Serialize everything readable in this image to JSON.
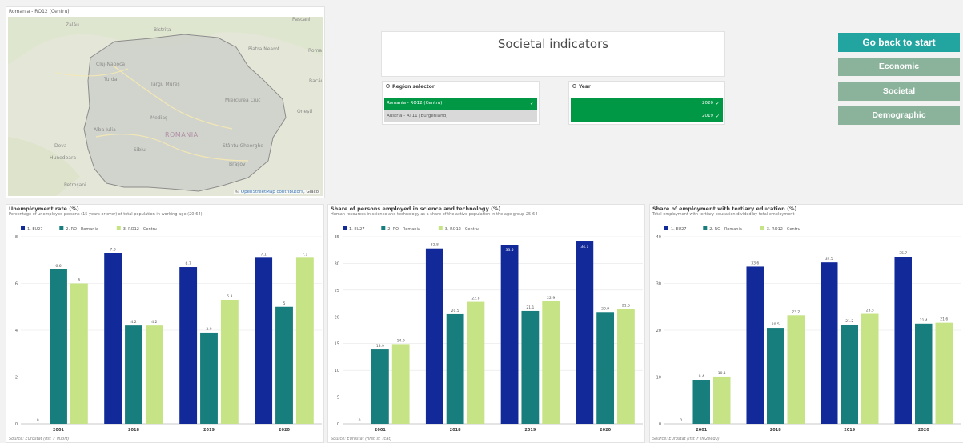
{
  "map": {
    "title": "Romania - RO12 (Centru)",
    "country_label": "ROMANIA",
    "places": [
      "Zalău",
      "Bistrița",
      "Pașcani",
      "Piatra Neamț",
      "Roma",
      "Cluj-Napoca",
      "Turda",
      "Târgu Mureș",
      "Bacău",
      "Miercurea Ciuc",
      "Onești",
      "Mediaș",
      "Alba Iulia",
      "Deva",
      "Sibiu",
      "Sfântu Gheorghe",
      "Hunedoara",
      "Brașov",
      "Petroșani"
    ],
    "attribution_prefix": "© ",
    "attribution_link": "OpenStreetMap contributors",
    "attribution_suffix": ", Glaco"
  },
  "header": {
    "title": "Societal indicators"
  },
  "region_filter": {
    "label": "Region selector",
    "items": [
      {
        "label": "Romania - RO12 (Centru)",
        "selected": true,
        "check": "✓"
      },
      {
        "label": "Austria - AT11 (Burgenland)",
        "selected": false,
        "check": ""
      }
    ]
  },
  "year_filter": {
    "label": "Year",
    "items": [
      {
        "label": "2020",
        "selected": true,
        "check": "✓"
      },
      {
        "label": "2019",
        "selected": true,
        "check": "✓"
      }
    ]
  },
  "nav": {
    "start": "Go back to start",
    "economic": "Economic",
    "societal": "Societal",
    "demographic": "Demographic"
  },
  "colors": {
    "eu27": "#12299a",
    "ro": "#177d7d",
    "region": "#c6e486",
    "select_green": "#009845",
    "start_btn": "#22a4a0",
    "nav_btn": "#8bb39b"
  },
  "chart_data": [
    {
      "type": "bar",
      "title": "Unemployment rate (%)",
      "subtitle": "Percentage of unemployed persons (15 years or over) of total population in working-age (20-64)",
      "source": "Source: Eurostat (lfst_r_lfu3rt)",
      "categories": [
        "2001",
        "2018",
        "2019",
        "2020"
      ],
      "series": [
        {
          "name": "1. EU27",
          "values": [
            0,
            7.3,
            6.7,
            7.1
          ],
          "labels": [
            "0",
            "7.3",
            "6.7",
            "7.1"
          ]
        },
        {
          "name": "2. RO - Romania",
          "values": [
            6.6,
            4.2,
            3.9,
            5
          ],
          "labels": [
            "6.6",
            "4.2",
            "3.9",
            "5"
          ]
        },
        {
          "name": "3. RO12 - Centru",
          "values": [
            6,
            4.2,
            5.3,
            7.1
          ],
          "labels": [
            "6",
            "4.2",
            "5.3",
            "7.1"
          ]
        }
      ],
      "ylim": [
        0,
        8
      ],
      "yticks": [
        0,
        2,
        4,
        6,
        8
      ],
      "legend": "top-left",
      "grid": true
    },
    {
      "type": "bar",
      "title": "Share of persons employed in science and technology (%)",
      "subtitle": "Human resources in science and technology as a share of the active population in the age group 25-64",
      "source": "Source: Eurostat (hrst_st_rcat)",
      "categories": [
        "2001",
        "2018",
        "2019",
        "2020"
      ],
      "series": [
        {
          "name": "1. EU27",
          "values": [
            0,
            32.8,
            33.5,
            34.1
          ],
          "labels": [
            "0",
            "32.8",
            "33.5",
            "34.1"
          ]
        },
        {
          "name": "2. RO - Romania",
          "values": [
            13.9,
            20.5,
            21.1,
            20.9
          ],
          "labels": [
            "13.9",
            "20.5",
            "21.1",
            "20.9"
          ]
        },
        {
          "name": "3. RO12 - Centru",
          "values": [
            14.9,
            22.8,
            22.9,
            21.5
          ],
          "labels": [
            "14.9",
            "22.8",
            "22.9",
            "21.5"
          ]
        }
      ],
      "ylim": [
        0,
        35
      ],
      "yticks": [
        0,
        5,
        10,
        15,
        20,
        25,
        30,
        35
      ],
      "legend": "top-left",
      "grid": true
    },
    {
      "type": "bar",
      "title": "Share of employment with tertiary education (%)",
      "subtitle": "Total employment with tertiary education divided by total employment",
      "source": "Source: Eurostat (lfst_r_lfe2eedu)",
      "categories": [
        "2001",
        "2018",
        "2019",
        "2020"
      ],
      "series": [
        {
          "name": "1. EU27",
          "values": [
            0,
            33.6,
            34.5,
            35.7
          ],
          "labels": [
            "0",
            "33.6",
            "34.5",
            "35.7"
          ]
        },
        {
          "name": "2. RO - Romania",
          "values": [
            9.4,
            20.5,
            21.2,
            21.4
          ],
          "labels": [
            "9.4",
            "20.5",
            "21.2",
            "21.4"
          ]
        },
        {
          "name": "3. RO12 - Centru",
          "values": [
            10.1,
            23.2,
            23.5,
            21.6
          ],
          "labels": [
            "10.1",
            "23.2",
            "23.5",
            "21.6"
          ]
        }
      ],
      "ylim": [
        0,
        40
      ],
      "yticks": [
        0,
        10,
        20,
        30,
        40
      ],
      "legend": "top-left",
      "grid": true
    }
  ]
}
